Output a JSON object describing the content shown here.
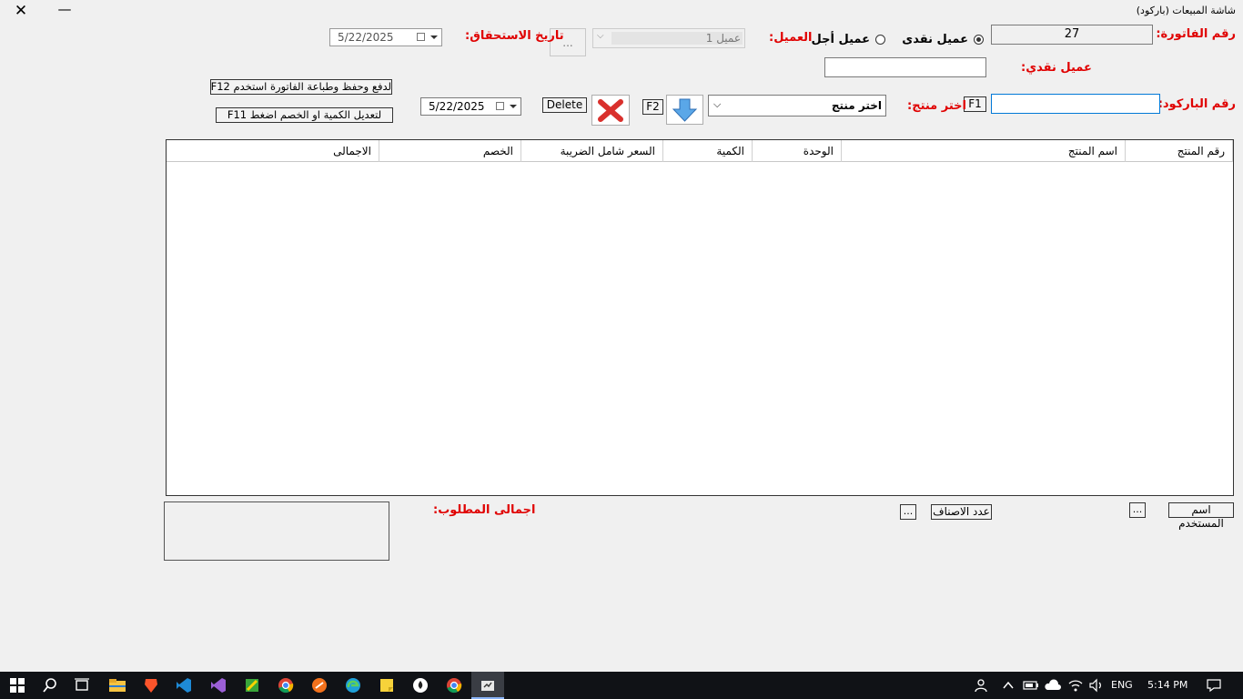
{
  "window": {
    "title": "شاشة المبيعات (باركود)"
  },
  "header": {
    "invoice_label": "رقم الفاتورة:",
    "invoice_value": "27",
    "cash_customer_option": "عميل نقدى",
    "credit_customer_option": "عميل أجل",
    "customer_label": "العميل:",
    "customer_value": "عميل 1",
    "browse_label": "...",
    "due_date_label": "تاريخ الاستحقاق:",
    "due_date_value": "5/22/2025",
    "cash_customer_label": "عميل نقدي:",
    "cash_customer_value": ""
  },
  "hints": {
    "pay_hint": "لدفع وحفظ وطباعة الفاتورة استخدم F12",
    "edit_hint": "لتعديل الكمية او الخصم اضغط F11"
  },
  "entry": {
    "barcode_label": "رقم الباركود:",
    "barcode_value": "",
    "f1": "F1",
    "product_label": "اختر منتج:",
    "product_placeholder": "اختر منتج",
    "f2": "F2",
    "delete_label": "Delete",
    "date_value": "5/22/2025"
  },
  "grid": {
    "columns": [
      "رقم المنتج",
      "اسم المنتج",
      "الوحدة",
      "الكمية",
      "السعر شامل الضريبة",
      "الخصم",
      "الاجمالى"
    ],
    "rows": []
  },
  "footer": {
    "username_label": "اسم المستخدم",
    "username_more": "...",
    "items_count_label": "عدد الاصناف",
    "items_count_more": "...",
    "total_label": "اجمالى المطلوب:",
    "total_value": ""
  },
  "taskbar": {
    "lang": "ENG",
    "time": "5:14 PM"
  }
}
